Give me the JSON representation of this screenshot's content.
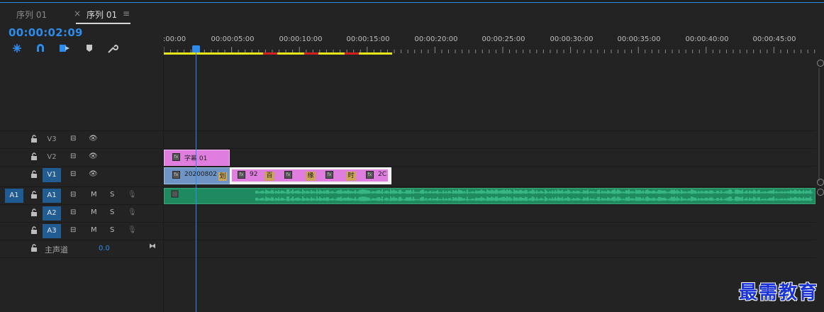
{
  "tabs": [
    {
      "label": "序列 01",
      "active": false
    },
    {
      "label": "序列 01",
      "active": true
    }
  ],
  "tab_close": "×",
  "tab_menu": "≡",
  "timecode": "00:00:02:09",
  "tools": [
    "snap-icon",
    "magnet-icon",
    "linked-selection-icon",
    "add-marker-icon",
    "wrench-icon"
  ],
  "ruler": {
    "labels": [
      ":00:00",
      "00:00:05:00",
      "00:00:10:00",
      "00:00:15:00",
      "00:00:20:00",
      "00:00:25:00",
      "00:00:30:00",
      "00:00:35:00",
      "00:00:40:00",
      "00:00:45:00"
    ]
  },
  "tracks": {
    "video": [
      {
        "name": "V3",
        "targeted": false
      },
      {
        "name": "V2",
        "targeted": false
      },
      {
        "name": "V1",
        "targeted": true
      }
    ],
    "audio": [
      {
        "source": "A1",
        "name": "A1",
        "mute": "M",
        "solo": "S"
      },
      {
        "name": "A2",
        "mute": "M",
        "solo": "S"
      },
      {
        "name": "A3",
        "mute": "M",
        "solo": "S"
      }
    ],
    "master": {
      "label": "主声道",
      "value": "0.0"
    }
  },
  "clips": {
    "v2_title": "字幕 01",
    "v1_main": "20200802",
    "v1_badge": "划",
    "v1_seq": [
      "92",
      "百",
      "缘",
      "时",
      "2C"
    ]
  },
  "watermark": "最需教育",
  "colors": {
    "accent": "#2d8ceb",
    "title_clip": "#e07ee0",
    "video_clip": "#6f95c6",
    "audio_clip": "#1f8a5f",
    "workbar": "#e7e619"
  }
}
